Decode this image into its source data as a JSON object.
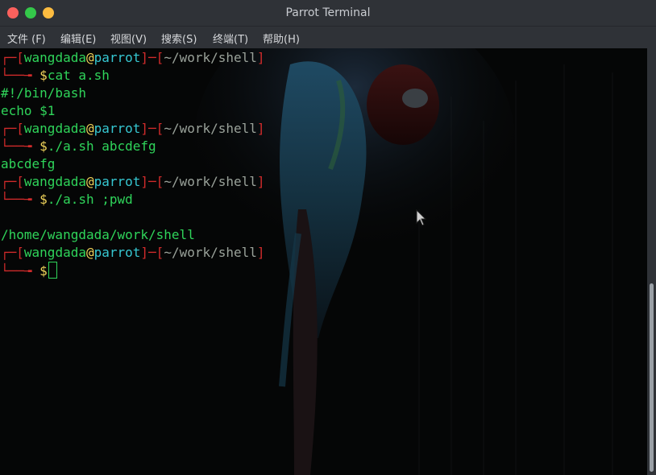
{
  "window": {
    "title": "Parrot Terminal"
  },
  "menu": {
    "file": "文件 (F)",
    "edit": "编辑(E)",
    "view": "视图(V)",
    "search": "搜索(S)",
    "terminal": "终端(T)",
    "help": "帮助(H)"
  },
  "prompt": {
    "user": "wangdada",
    "at": "@",
    "host": "parrot",
    "dir": "~/work/shell",
    "symbol": "$"
  },
  "session": {
    "cmd1": "cat a.sh",
    "out1a": "#!/bin/bash",
    "out1b": "echo $1",
    "cmd2": "./a.sh abcdefg",
    "out2": "abcdefg",
    "cmd3": "./a.sh ;pwd",
    "out3": "/home/wangdada/work/shell"
  },
  "colors": {
    "prompt_frame": "#d12b2b",
    "user": "#2fd45a",
    "host": "#36c7d1",
    "dollar": "#f0d35a",
    "output": "#2fd45a"
  }
}
